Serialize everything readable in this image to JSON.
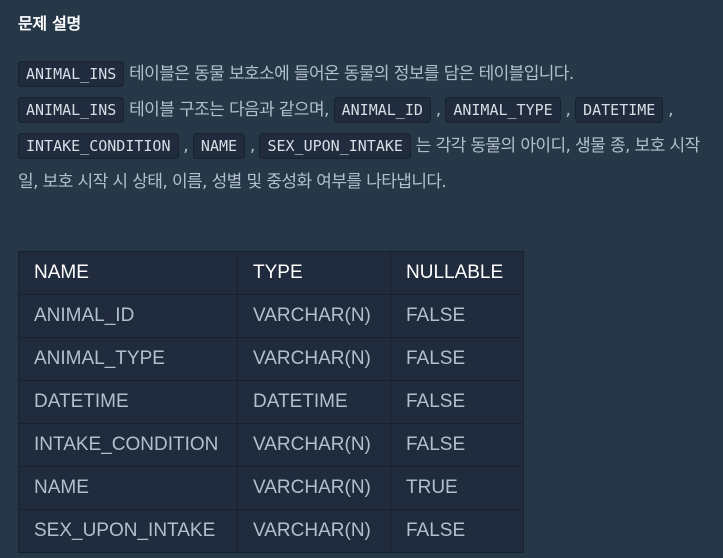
{
  "section": {
    "title": "문제 설명"
  },
  "description": {
    "p1_code": "ANIMAL_INS",
    "p1_text": " 테이블은 동물 보호소에 들어온 동물의 정보를 담은 테이블입니다.",
    "p2_code": "ANIMAL_INS",
    "p2_text": " 테이블 구조는 다음과 같으며, ",
    "columns": [
      "ANIMAL_ID",
      "ANIMAL_TYPE",
      "DATETIME",
      "INTAKE_CONDITION",
      "NAME",
      "SEX_UPON_INTAKE"
    ],
    "separator": " , ",
    "p2_tail": " 는 각각 동물의 아이디, 생물 종, 보호 시작일, 보호 시작 시 상태, 이름, 성별 및 중성화 여부를 나타냅니다."
  },
  "table": {
    "headers": [
      "NAME",
      "TYPE",
      "NULLABLE"
    ],
    "rows": [
      [
        "ANIMAL_ID",
        "VARCHAR(N)",
        "FALSE"
      ],
      [
        "ANIMAL_TYPE",
        "VARCHAR(N)",
        "FALSE"
      ],
      [
        "DATETIME",
        "DATETIME",
        "FALSE"
      ],
      [
        "INTAKE_CONDITION",
        "VARCHAR(N)",
        "FALSE"
      ],
      [
        "NAME",
        "VARCHAR(N)",
        "TRUE"
      ],
      [
        "SEX_UPON_INTAKE",
        "VARCHAR(N)",
        "FALSE"
      ]
    ]
  }
}
